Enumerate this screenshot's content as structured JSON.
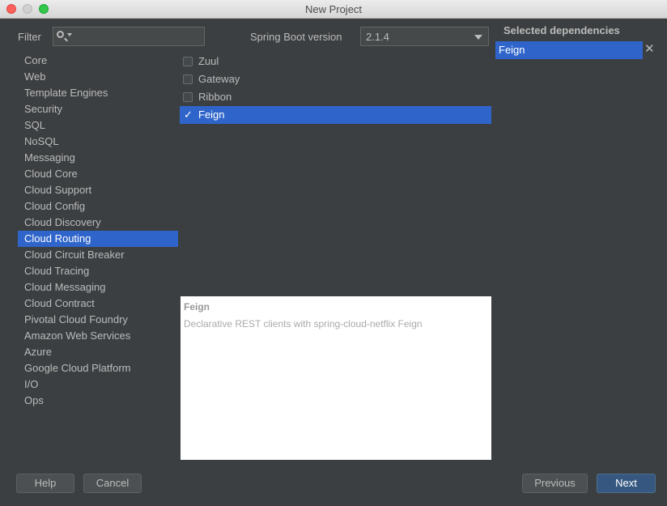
{
  "window": {
    "title": "New Project"
  },
  "filter": {
    "label": "Filter",
    "value": "",
    "placeholder": ""
  },
  "version": {
    "label": "Spring Boot version",
    "selected": "2.1.4"
  },
  "categories": [
    "Core",
    "Web",
    "Template Engines",
    "Security",
    "SQL",
    "NoSQL",
    "Messaging",
    "Cloud Core",
    "Cloud Support",
    "Cloud Config",
    "Cloud Discovery",
    "Cloud Routing",
    "Cloud Circuit Breaker",
    "Cloud Tracing",
    "Cloud Messaging",
    "Cloud Contract",
    "Pivotal Cloud Foundry",
    "Amazon Web Services",
    "Azure",
    "Google Cloud Platform",
    "I/O",
    "Ops"
  ],
  "selected_category": "Cloud Routing",
  "dependencies": [
    {
      "label": "Zuul",
      "checked": false
    },
    {
      "label": "Gateway",
      "checked": false
    },
    {
      "label": "Ribbon",
      "checked": false
    },
    {
      "label": "Feign",
      "checked": true
    }
  ],
  "description": {
    "title": "Feign",
    "text": "Declarative REST clients with spring-cloud-netflix Feign"
  },
  "selected_dependencies": {
    "header": "Selected dependencies",
    "items": [
      "Feign"
    ]
  },
  "buttons": {
    "help": "Help",
    "cancel": "Cancel",
    "previous": "Previous",
    "next": "Next"
  },
  "icons": {
    "check": "✓",
    "remove": "✕"
  }
}
